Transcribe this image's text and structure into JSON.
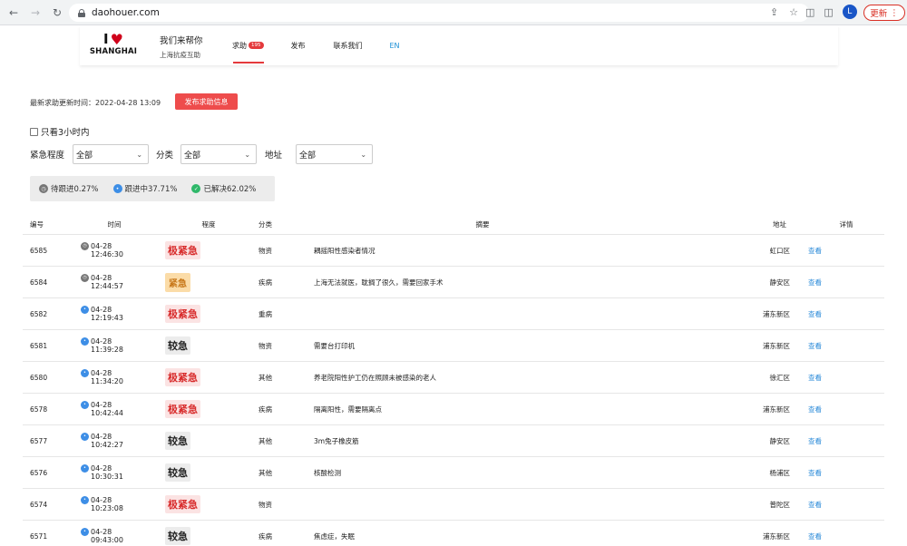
{
  "browser": {
    "url": "daohouer.com",
    "profile_initial": "L",
    "update_label": "更新"
  },
  "site": {
    "logo_top": "I",
    "logo_city": "SHANGHAI",
    "tagline_title": "我们来帮你",
    "tagline_sub": "上海抗疫互助",
    "nav": [
      {
        "label": "求助",
        "badge": "195",
        "active": true
      },
      {
        "label": "发布"
      },
      {
        "label": "联系我们"
      },
      {
        "label": "EN"
      }
    ]
  },
  "toolbar": {
    "last_update": "最新求助更新时间：2022-04-28 13:09",
    "publish_button": "发布求助信息",
    "only_3h": "只看3小时内"
  },
  "filters": {
    "urgency_label": "紧急程度",
    "urgency_value": "全部",
    "category_label": "分类",
    "category_value": "全部",
    "address_label": "地址",
    "address_value": "全部"
  },
  "stats": {
    "pending": "待跟进0.27%",
    "following": "跟进中37.71%",
    "resolved": "已解决62.02%"
  },
  "table": {
    "headers": [
      "编号",
      "时间",
      "程度",
      "分类",
      "摘要",
      "地址",
      "详情"
    ],
    "rows": [
      {
        "id": "6585",
        "status": "gray",
        "date": "04-28",
        "time": "12:46:30",
        "level": "极紧急",
        "level_type": "urgent-max",
        "category": "物资",
        "summary": "耦摇阳性感染者情况",
        "address": "虹口区",
        "detail": "查看"
      },
      {
        "id": "6584",
        "status": "gray",
        "date": "04-28",
        "time": "12:44:57",
        "level": "紧急",
        "level_type": "urgent",
        "category": "疾病",
        "summary": "上海无法就医，耽搁了很久，需要回家手术",
        "address": "静安区",
        "detail": "查看"
      },
      {
        "id": "6582",
        "status": "blue",
        "date": "04-28",
        "time": "12:19:43",
        "level": "极紧急",
        "level_type": "urgent-max",
        "category": "重病",
        "summary": "",
        "address": "浦东新区",
        "detail": "查看"
      },
      {
        "id": "6581",
        "status": "blue",
        "date": "04-28",
        "time": "11:39:28",
        "level": "较急",
        "level_type": "normal",
        "category": "物资",
        "summary": "需要台打印机",
        "address": "浦东新区",
        "detail": "查看"
      },
      {
        "id": "6580",
        "status": "blue",
        "date": "04-28",
        "time": "11:34:20",
        "level": "极紧急",
        "level_type": "urgent-max",
        "category": "其他",
        "summary": "养老院阳性护工仍在照顾未被感染的老人",
        "address": "徐汇区",
        "detail": "查看"
      },
      {
        "id": "6578",
        "status": "blue",
        "date": "04-28",
        "time": "10:42:44",
        "level": "极紧急",
        "level_type": "urgent-max",
        "category": "疾病",
        "summary": "隔离阳性，需要隔离点",
        "address": "浦东新区",
        "detail": "查看"
      },
      {
        "id": "6577",
        "status": "blue",
        "date": "04-28",
        "time": "10:42:27",
        "level": "较急",
        "level_type": "normal",
        "category": "其他",
        "summary": "3m兔子橡皮筋",
        "address": "静安区",
        "detail": "查看"
      },
      {
        "id": "6576",
        "status": "blue",
        "date": "04-28",
        "time": "10:30:31",
        "level": "较急",
        "level_type": "normal",
        "category": "其他",
        "summary": "核酸检测",
        "address": "杨浦区",
        "detail": "查看"
      },
      {
        "id": "6574",
        "status": "blue",
        "date": "04-28",
        "time": "10:23:08",
        "level": "极紧急",
        "level_type": "urgent-max",
        "category": "物资",
        "summary": "",
        "address": "普陀区",
        "detail": "查看"
      },
      {
        "id": "6571",
        "status": "blue",
        "date": "04-28",
        "time": "09:43:00",
        "level": "较急",
        "level_type": "normal",
        "category": "疾病",
        "summary": "焦虑症，失眠",
        "address": "浦东新区",
        "detail": "查看"
      }
    ]
  }
}
